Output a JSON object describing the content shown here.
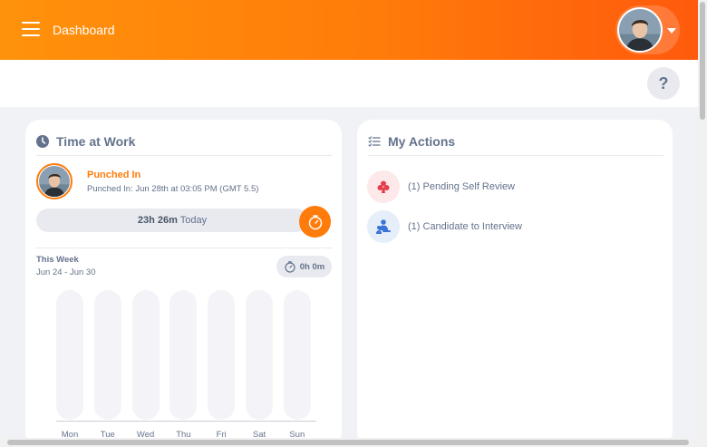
{
  "topbar": {
    "title": "Dashboard",
    "menu_icon": "hamburger-menu-icon",
    "user_dropdown_icon": "caret-down-icon"
  },
  "subbar": {
    "help_label": "?"
  },
  "time_at_work": {
    "title": "Time at Work",
    "title_icon": "clock-icon",
    "status": "Punched In",
    "punched_in_text": "Punched In: Jun 28th at 03:05 PM (GMT 5.5)",
    "today_hours": "23h 26m",
    "today_label": "Today",
    "stopwatch_icon": "stopwatch-icon",
    "week_label": "This Week",
    "week_range": "Jun 24 - Jun 30",
    "week_total": "0h 0m"
  },
  "chart_data": {
    "type": "bar",
    "categories": [
      "Mon",
      "Tue",
      "Wed",
      "Thu",
      "Fri",
      "Sat",
      "Sun"
    ],
    "values": [
      0,
      0,
      0,
      0,
      0,
      0,
      0
    ]
  },
  "my_actions": {
    "title": "My Actions",
    "title_icon": "list-icon",
    "items": [
      {
        "label": "(1) Pending Self Review",
        "icon": "self-review-icon",
        "color": "#e53e4f",
        "bg": "#fde8ea"
      },
      {
        "label": "(1) Candidate to Interview",
        "icon": "candidate-interview-icon",
        "color": "#3c73d9",
        "bg": "#e6eef9"
      }
    ]
  },
  "colors": {
    "accent": "#ff7b0a",
    "text": "#64728c"
  }
}
